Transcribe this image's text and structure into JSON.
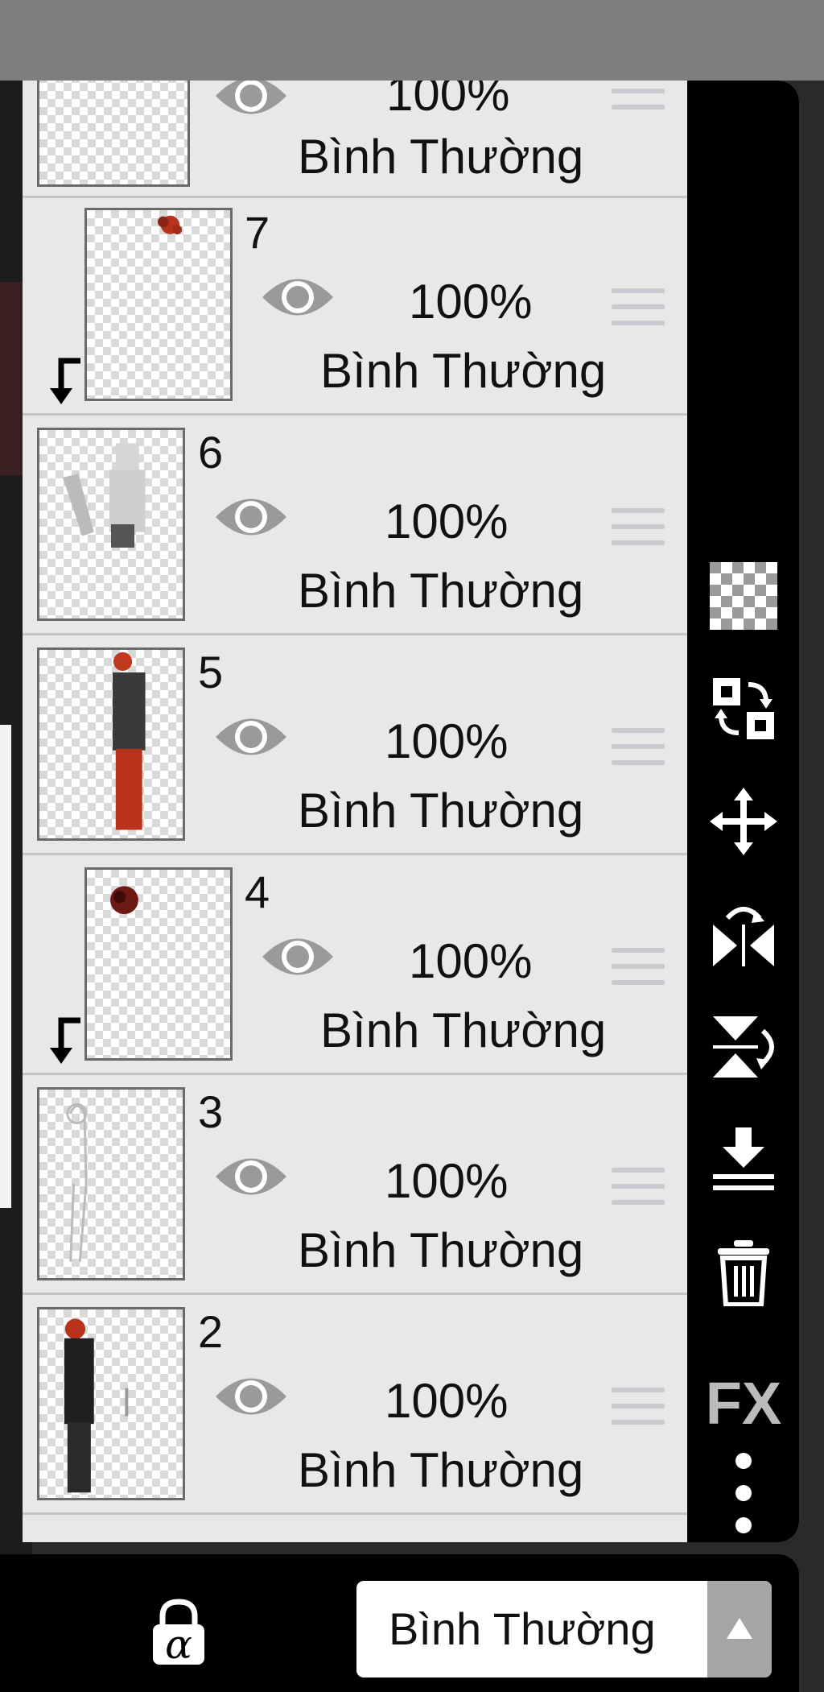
{
  "partial_layer_top": {
    "opacity": "100%",
    "blend": "Bình Thường"
  },
  "layers": [
    {
      "number": "7",
      "opacity": "100%",
      "blend": "Bình Thường",
      "clipped": true
    },
    {
      "number": "6",
      "opacity": "100%",
      "blend": "Bình Thường",
      "clipped": false
    },
    {
      "number": "5",
      "opacity": "100%",
      "blend": "Bình Thường",
      "clipped": false
    },
    {
      "number": "4",
      "opacity": "100%",
      "blend": "Bình Thường",
      "clipped": true
    },
    {
      "number": "3",
      "opacity": "100%",
      "blend": "Bình Thường",
      "clipped": false
    },
    {
      "number": "2",
      "opacity": "100%",
      "blend": "Bình Thường",
      "clipped": false
    }
  ],
  "toolbar": {
    "icons": [
      "transparency-checker-icon",
      "swap-layer-icon",
      "move-icon",
      "flip-horizontal-icon",
      "flip-vertical-icon",
      "merge-down-icon",
      "trash-icon",
      "fx-icon",
      "more-options-icon"
    ],
    "fx_label": "FX"
  },
  "bottom": {
    "alpha_lock_symbol": "α",
    "blend_mode_value": "Bình Thường"
  },
  "colors": {
    "toolbar": "#000000",
    "panel": "#e8e8e8",
    "accent_red": "#b8321c",
    "handle": "#c9c9cf"
  }
}
